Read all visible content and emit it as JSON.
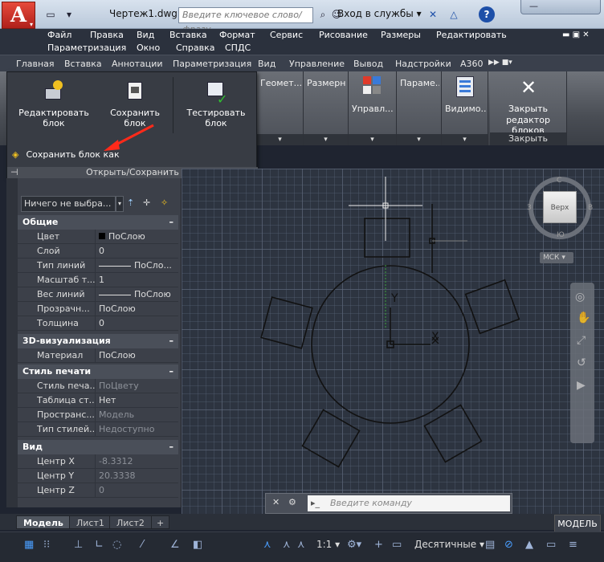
{
  "app": {
    "logo_letter": "A",
    "title": "Чертеж1.dwg",
    "search_placeholder": "Введите ключевое слово/фразу",
    "login": "Вход в службы",
    "login_caret": "▾",
    "window_min": "—"
  },
  "menubar": {
    "row1": [
      "Файл",
      "Правка",
      "Вид",
      "Вставка",
      "Формат",
      "Сервис",
      "Рисование",
      "Размеры",
      "Редактировать"
    ],
    "row2": [
      "Параметризация",
      "Окно",
      "Справка",
      "СПДС"
    ]
  },
  "ribbon_tabs": [
    "Главная",
    "Вставка",
    "Аннотации",
    "Параметризация",
    "Вид",
    "Управление",
    "Вывод",
    "Надстройки",
    "A360"
  ],
  "ribbon_panels": {
    "geometry": "Геомет...",
    "dimensions": "Размерн...",
    "manage": "Управл...",
    "params": "Параме...",
    "visibility": "Видимо...",
    "close_label_1": "Закрыть",
    "close_label_2": "редактор блоков",
    "close_footer": "Закрыть"
  },
  "flyout": {
    "edit_block": "Редактировать блок",
    "save_block": "Сохранить блок",
    "test_block": "Тестировать блок",
    "save_block_as": "Сохранить блок как",
    "footer": "Открыть/Сохранить"
  },
  "properties": {
    "selection": "Ничего не выбра...",
    "general_header": "Общие",
    "general": [
      {
        "k": "Цвет",
        "v": "ПоСлою",
        "dim": false
      },
      {
        "k": "Слой",
        "v": "0",
        "dim": false
      },
      {
        "k": "Тип линий",
        "v": "ПоСло...",
        "dim": false
      },
      {
        "k": "Масштаб т...",
        "v": "1",
        "dim": false
      },
      {
        "k": "Вес линий",
        "v": "ПоСлою",
        "dim": false
      },
      {
        "k": "Прозрачн...",
        "v": "ПоСлою",
        "dim": false
      },
      {
        "k": "Толщина",
        "v": "0",
        "dim": false
      }
    ],
    "viz_header": "3D-визуализация",
    "material": {
      "k": "Материал",
      "v": "ПоСлою"
    },
    "print_header": "Стиль печати",
    "print": [
      {
        "k": "Стиль печа...",
        "v": "ПоЦвету",
        "dim": true
      },
      {
        "k": "Таблица ст...",
        "v": "Нет",
        "dim": false
      },
      {
        "k": "Пространс...",
        "v": "Модель",
        "dim": true
      },
      {
        "k": "Тип стилей...",
        "v": "Недоступно",
        "dim": true
      }
    ],
    "view_header": "Вид",
    "view": [
      {
        "k": "Центр X",
        "v": "-8.3312",
        "dim": true
      },
      {
        "k": "Центр Y",
        "v": "20.3338",
        "dim": true
      },
      {
        "k": "Центр Z",
        "v": "0",
        "dim": true
      }
    ]
  },
  "viewcube": {
    "top": "Верх",
    "n": "С",
    "s": "Ю",
    "w": "З",
    "e": "В",
    "ucs": "МСК"
  },
  "canvas": {
    "y_label": "Y",
    "x_label": "X"
  },
  "command": {
    "placeholder": "Введите команду"
  },
  "tabs": [
    "Модель",
    "Лист1",
    "Лист2"
  ],
  "status": {
    "scale": "1:1",
    "units": "Десятичные",
    "model_badge": "МОДЕЛЬ"
  },
  "colors": {
    "accent_red": "#e0281e",
    "arrow": "#ff2a1a",
    "ribbon": "#4a4e55"
  }
}
